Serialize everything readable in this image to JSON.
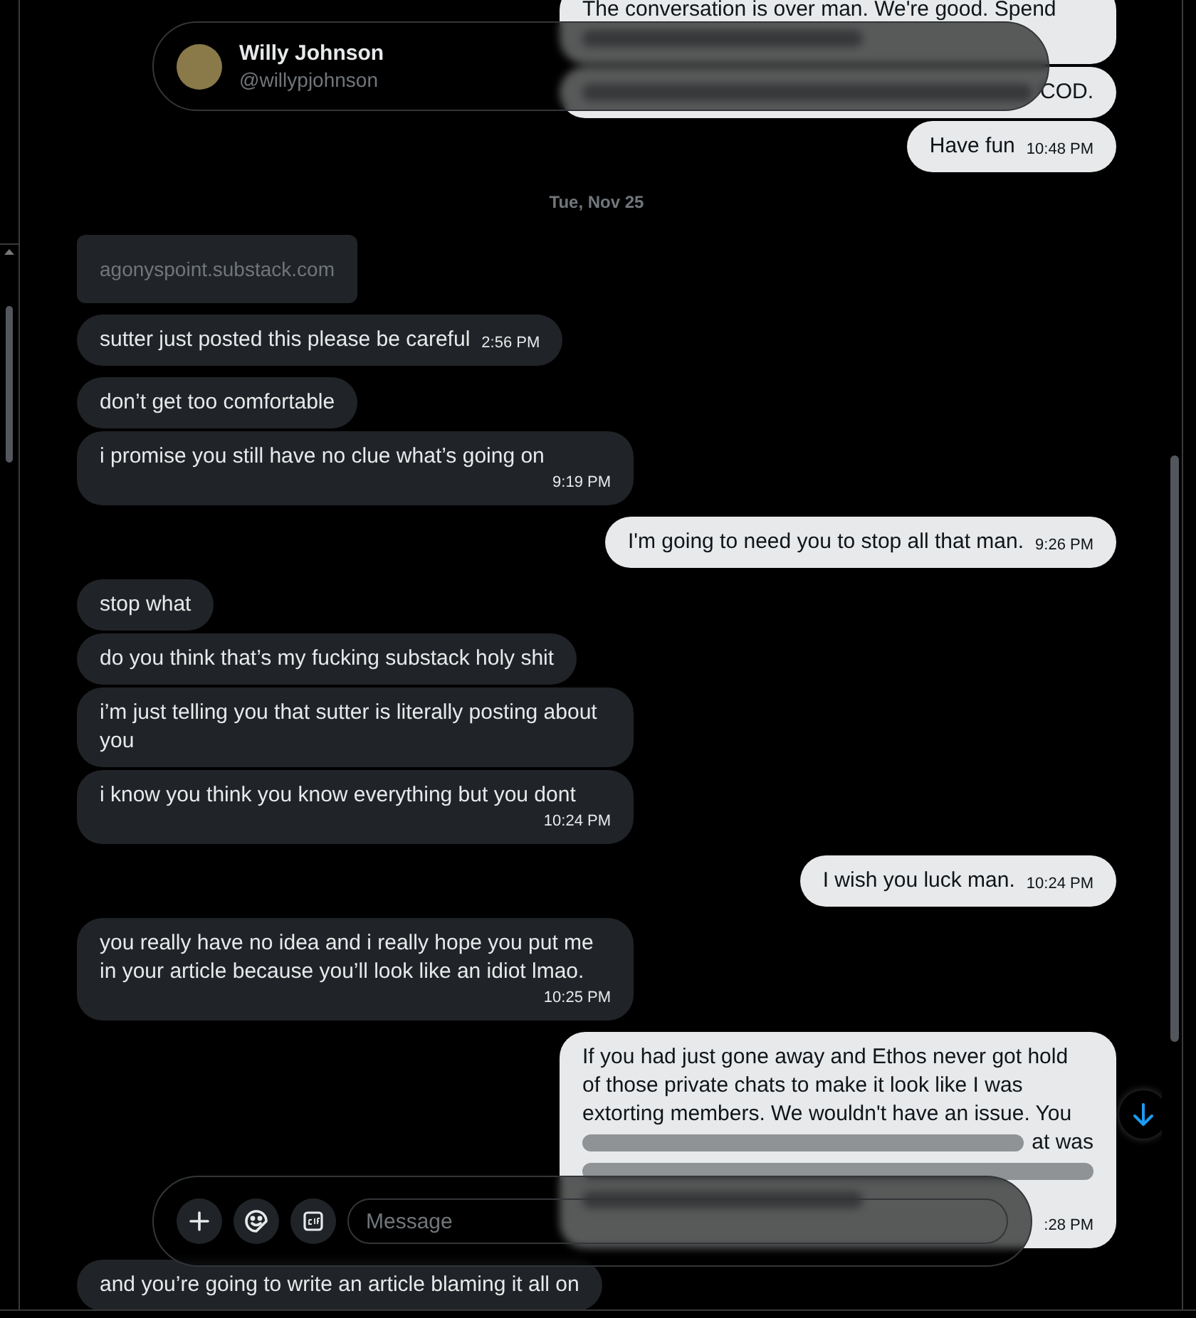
{
  "header": {
    "name": "Willy Johnson",
    "handle": "@willypjohnson"
  },
  "messages": [
    {
      "kind": "text",
      "outgoing": true,
      "lines": [
        {
          "kind": "text",
          "text": "The conversation is over man. We're good. Spend"
        },
        {
          "kind": "blurred"
        }
      ]
    },
    {
      "kind": "text",
      "outgoing": true,
      "lines": [
        {
          "kind": "mixed",
          "text": "COD."
        }
      ]
    },
    {
      "kind": "text",
      "outgoing": true,
      "text": "Have fun",
      "time": "10:48 PM"
    },
    {
      "kind": "date",
      "text": "Tue, Nov 25"
    },
    {
      "kind": "link",
      "outgoing": false,
      "text": "agonyspoint.substack.com"
    },
    {
      "kind": "text",
      "outgoing": false,
      "text": "sutter just posted this please be careful",
      "time": "2:56 PM"
    },
    {
      "kind": "text",
      "outgoing": false,
      "text": "don’t get too comfortable"
    },
    {
      "kind": "text",
      "outgoing": false,
      "text": "i promise you still have no clue what’s going on",
      "time": "9:19 PM"
    },
    {
      "kind": "text",
      "outgoing": true,
      "text": "I'm going to need you to stop all that man.",
      "time": "9:26 PM"
    },
    {
      "kind": "text",
      "outgoing": false,
      "text": "stop what"
    },
    {
      "kind": "text",
      "outgoing": false,
      "text": "do you think that’s my fucking substack holy shit"
    },
    {
      "kind": "text",
      "outgoing": false,
      "text": "i’m just telling you that sutter is literally posting about you"
    },
    {
      "kind": "text",
      "outgoing": false,
      "text": "i know you think you know everything but you dont",
      "time": "10:24 PM"
    },
    {
      "kind": "text",
      "outgoing": true,
      "text": "I wish you luck man.",
      "time": "10:24 PM"
    },
    {
      "kind": "text",
      "outgoing": false,
      "text": "you really have no idea and i really hope you put me in your article because you’ll look like an idiot lmao.",
      "time": "10:25 PM"
    },
    {
      "kind": "text",
      "outgoing": true,
      "lines": [
        {
          "kind": "text",
          "text": "If you had just gone away and Ethos never got hold"
        },
        {
          "kind": "text",
          "text": "of those private chats to make it look like I was"
        },
        {
          "kind": "text",
          "text": "extorting members. We wouldn't have an issue. You"
        },
        {
          "kind": "mixed",
          "text": "at was"
        },
        {
          "kind": "blurred"
        },
        {
          "kind": "blurred"
        }
      ],
      "time": ":28 PM"
    },
    {
      "kind": "text",
      "outgoing": false,
      "text": "and you’re going to write an article blaming it all on"
    }
  ],
  "composer": {
    "placeholder": "Message"
  }
}
